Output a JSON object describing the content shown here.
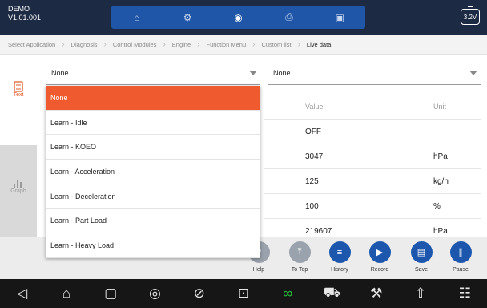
{
  "app": {
    "name": "DEMO",
    "version": "V1.01.001"
  },
  "modes": [
    {
      "icon": "home-icon",
      "glyph": "⌂"
    },
    {
      "icon": "settings-gear-icon",
      "glyph": "⚙"
    },
    {
      "icon": "record-dot-icon",
      "glyph": "◉"
    },
    {
      "icon": "print-icon",
      "glyph": "⎙"
    },
    {
      "icon": "image-icon",
      "glyph": "▣"
    }
  ],
  "battery": {
    "label": "3.2V"
  },
  "breadcrumb": [
    "Select Application",
    "Diagnosis",
    "Control Modules",
    "Engine",
    "Function Menu",
    "Custom list",
    "Live data"
  ],
  "left_tabs": {
    "text": "Text",
    "graph": "Graph"
  },
  "select_left": {
    "value": "None"
  },
  "select_right": {
    "value": "None"
  },
  "dropdown": {
    "items": [
      "None",
      "Learn - Idle",
      "Learn - KOEO",
      "Learn - Acceleration",
      "Learn - Deceleration",
      "Learn - Part Load",
      "Learn - Heavy Load"
    ],
    "selected_index": 0
  },
  "table": {
    "headers": {
      "value": "Value",
      "unit": "Unit"
    },
    "rows": [
      {
        "value": "OFF",
        "unit": ""
      },
      {
        "value": "3047",
        "unit": "hPa"
      },
      {
        "value": "125",
        "unit": "kg/h"
      },
      {
        "value": "100",
        "unit": "%"
      },
      {
        "value": "219607",
        "unit": "hPa"
      }
    ]
  },
  "actions": {
    "help": "Help",
    "to_top": "To Top",
    "history": "History",
    "record": "Record",
    "save": "Save",
    "pause": "Pause"
  },
  "colors": {
    "topbar": "#1c2a44",
    "accent": "#ef5b2e",
    "blue": "#1c57ad",
    "active_nav": "#28c43a"
  }
}
